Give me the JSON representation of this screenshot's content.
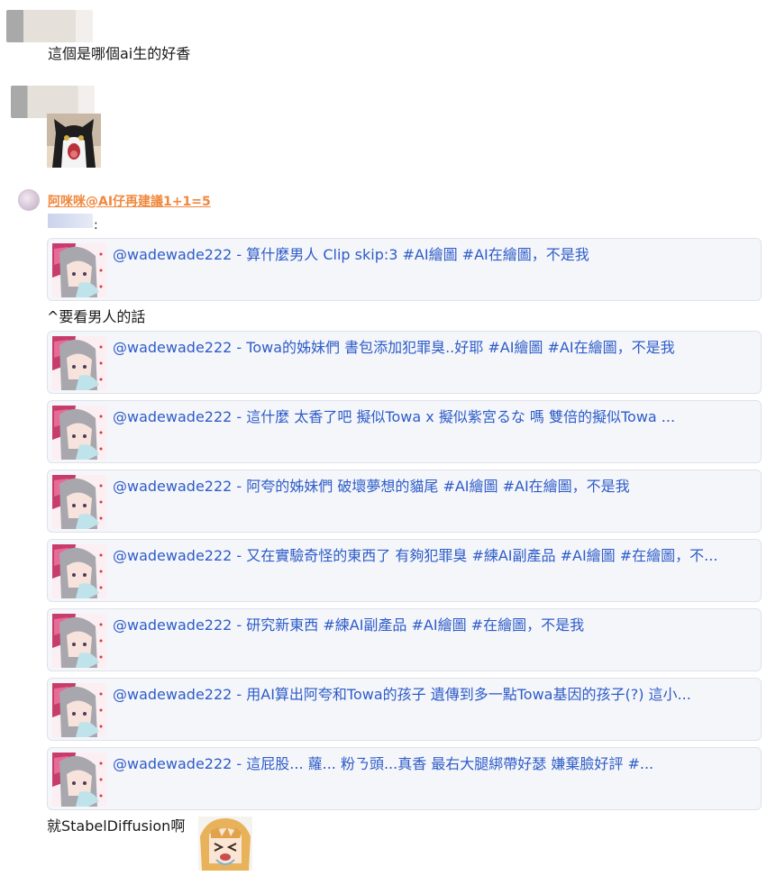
{
  "messages": [
    {
      "text": "這個是哪個ai生的好香"
    },
    {
      "text": ""
    }
  ],
  "reply": {
    "username": "阿咪咪@AI仔再建議1+1=5",
    "colon": ":",
    "middle_text": "^要看男人的話",
    "footer_text": "就StabelDiffusion啊"
  },
  "cards": [
    {
      "text": "@wadewade222 - 算什麼男人 Clip skip:3 #AI繪圖 #AI在繪圖，不是我"
    },
    {
      "text": "@wadewade222 - Towa的姊妹們 書包添加犯罪臭..好耶 #AI繪圖 #AI在繪圖，不是我"
    },
    {
      "text": "@wadewade222 - 這什麼 太香了吧 擬似Towa x 擬似紫宮るな 嗎 雙倍的擬似Towa ..."
    },
    {
      "text": "@wadewade222 - 阿夸的姊妹們 破壞夢想的貓尾 #AI繪圖 #AI在繪圖，不是我"
    },
    {
      "text": "@wadewade222 - 又在實驗奇怪的東西了 有夠犯罪臭 #練AI副產品 #AI繪圖 #在繪圖，不..."
    },
    {
      "text": "@wadewade222 - 研究新東西 #練AI副產品 #AI繪圖 #在繪圖，不是我"
    },
    {
      "text": "@wadewade222 - 用AI算出阿夸和Towa的孩子 遺傳到多一點Towa基因的孩子(?) 這小..."
    },
    {
      "text": "@wadewade222 - 這屁股... 蘿... 粉ㄋ頭...真香 最右大腿綁帶好瑟 嫌棄臉好評 #..."
    }
  ],
  "icons": {
    "cat_sticker": "screaming-cat-sticker",
    "card_thumb": "anime-girl-thumbnail",
    "anime_sticker": "anime-girl-crying-sticker"
  }
}
